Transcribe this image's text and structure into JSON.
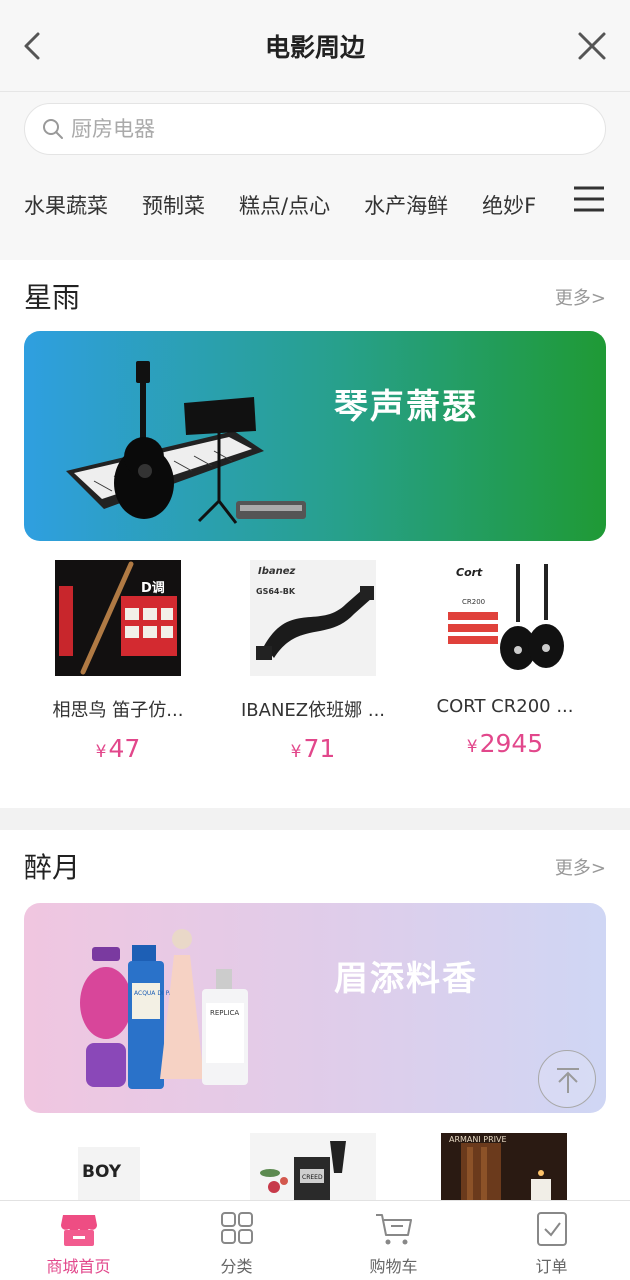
{
  "header": {
    "title": "电影周边"
  },
  "search": {
    "placeholder": "厨房电器"
  },
  "categories": [
    "水果蔬菜",
    "预制菜",
    "糕点/点心",
    "水产海鲜",
    "绝妙F"
  ],
  "sections": [
    {
      "title": "星雨",
      "more": "更多>",
      "banner_text": "琴声萧瑟",
      "products": [
        {
          "name": "相思鸟 笛子仿...",
          "price": "47"
        },
        {
          "name": "IBANEZ依班娜 ...",
          "price": "71"
        },
        {
          "name": "CORT CR200 ...",
          "price": "2945"
        }
      ]
    },
    {
      "title": "醉月",
      "more": "更多>",
      "banner_text": "眉添料香"
    }
  ],
  "product_image_texts": {
    "flute_box": "D调",
    "strap_brand": "Ibanez",
    "strap_model": "GS64-BK",
    "cort_brand": "Cort",
    "cort_model": "CR200",
    "boy_text": "BOY",
    "creed_text": "CREED",
    "armani_text": "ARMANI PRIVE",
    "perfume_acqua": "ACQUA DI PARMA",
    "perfume_replica": "REPLICA"
  },
  "currency": "¥",
  "tabbar": [
    {
      "label": "商城首页",
      "active": true,
      "icon": "shop-icon"
    },
    {
      "label": "分类",
      "active": false,
      "icon": "grid-icon"
    },
    {
      "label": "购物车",
      "active": false,
      "icon": "cart-icon"
    },
    {
      "label": "订单",
      "active": false,
      "icon": "order-icon"
    }
  ],
  "colors": {
    "accent": "#e2478b",
    "banner1_start": "#2f9fe0",
    "banner1_end": "#1f9a35",
    "banner2_start": "#f0c6e0",
    "banner2_end": "#cfd6f4"
  }
}
